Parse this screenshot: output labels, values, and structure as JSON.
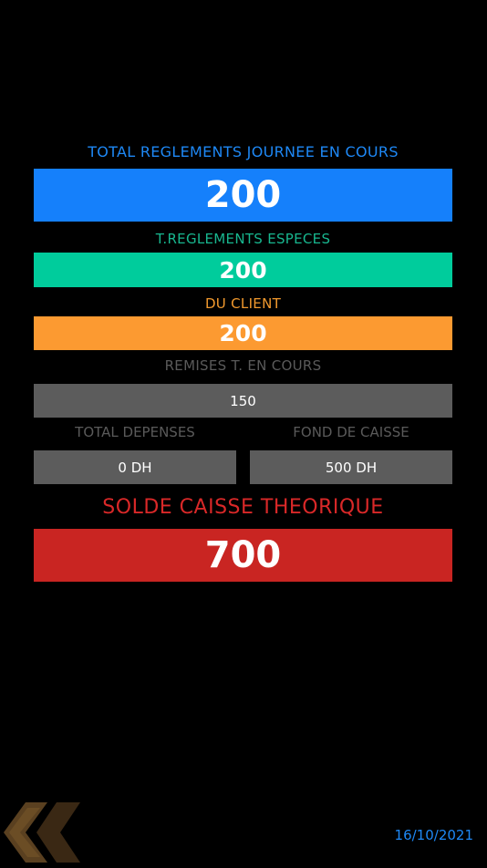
{
  "total_reglements": {
    "label": "TOTAL REGLEMENTS JOURNEE EN COURS",
    "value": "200",
    "color": "#1580fb"
  },
  "reglements_especes": {
    "label": "T.REGLEMENTS ESPECES",
    "value": "200",
    "color": "#00cc9c"
  },
  "du_client": {
    "label": "DU CLIENT",
    "value": "200",
    "color": "#fc9a31"
  },
  "remises": {
    "label": "REMISES T. EN COURS",
    "value": "150",
    "color": "#5c5c5c"
  },
  "total_depenses": {
    "label": "TOTAL DEPENSES",
    "value": "0 DH"
  },
  "fond_de_caisse": {
    "label": "FOND DE CAISSE",
    "value": "500 DH"
  },
  "solde_caisse": {
    "label": "SOLDE CAISSE THEORIQUE",
    "value": "700",
    "color": "#c92522"
  },
  "footer": {
    "back_icon": "double-chevron-left-icon",
    "date": "16/10/2021"
  }
}
